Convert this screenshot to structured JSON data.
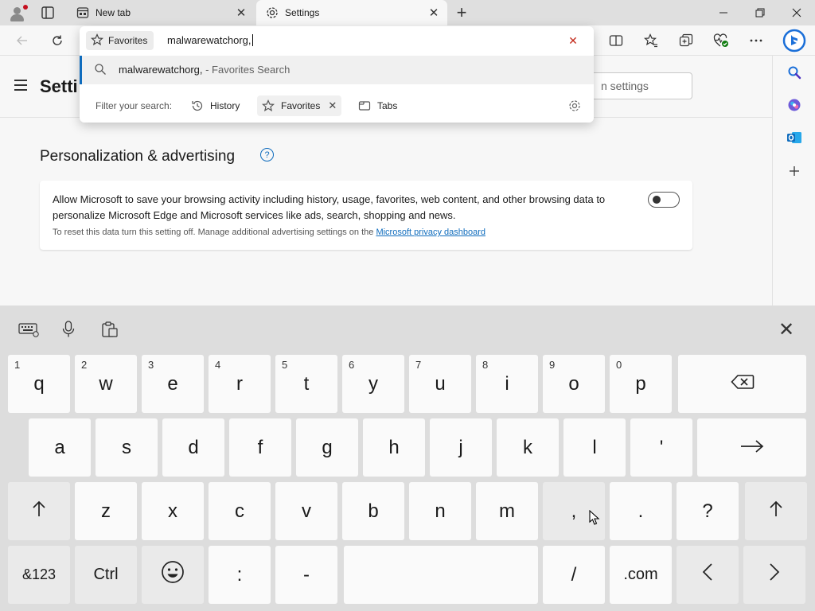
{
  "tabs": [
    {
      "label": "New tab",
      "icon": "newtab-page-icon"
    },
    {
      "label": "Settings",
      "icon": "gear-icon"
    }
  ],
  "settings": {
    "title": "Setti",
    "search_placeholder": "n settings",
    "section_title": "Personalization & advertising",
    "card_text": "Allow Microsoft to save your browsing activity including history, usage, favorites, web content, and other browsing data to personalize Microsoft Edge and Microsoft services like ads, search, shopping and news.",
    "card_sub": "To reset this data turn this setting off. Manage additional advertising settings on the",
    "card_link": "Microsoft privacy dashboard",
    "toggle_on": false
  },
  "omnibox": {
    "scope_chip": "Favorites",
    "query": "malwarewatchorg,",
    "suggestion_query": "malwarewatchorg,",
    "suggestion_suffix": " - Favorites Search",
    "filter_label": "Filter your search:",
    "filters": [
      {
        "label": "History",
        "active": false
      },
      {
        "label": "Favorites",
        "active": true
      },
      {
        "label": "Tabs",
        "active": false
      }
    ]
  },
  "keyboard": {
    "row1": [
      {
        "key": "q",
        "hint": "1"
      },
      {
        "key": "w",
        "hint": "2"
      },
      {
        "key": "e",
        "hint": "3"
      },
      {
        "key": "r",
        "hint": "4"
      },
      {
        "key": "t",
        "hint": "5"
      },
      {
        "key": "y",
        "hint": "6"
      },
      {
        "key": "u",
        "hint": "7"
      },
      {
        "key": "i",
        "hint": "8"
      },
      {
        "key": "o",
        "hint": "9"
      },
      {
        "key": "p",
        "hint": "0"
      }
    ],
    "row2": [
      "a",
      "s",
      "d",
      "f",
      "g",
      "h",
      "j",
      "k",
      "l",
      "'"
    ],
    "row3": [
      "z",
      "x",
      "c",
      "v",
      "b",
      "n",
      "m",
      ",",
      ".",
      "?"
    ],
    "row4": {
      "symbols": "&123",
      "ctrl": "Ctrl",
      "colon": ":",
      "dash": "-",
      "slash": "/",
      "dotcom": ".com"
    },
    "icons": {
      "backspace": "⌫",
      "enter": "→",
      "shift": "↑",
      "emoji": "☺",
      "left": "‹",
      "right": "›",
      "close": "✕"
    }
  },
  "colors": {
    "accent": "#0f6cbd",
    "clear": "#c42b1c",
    "keyboard_bg": "#dddddd"
  }
}
